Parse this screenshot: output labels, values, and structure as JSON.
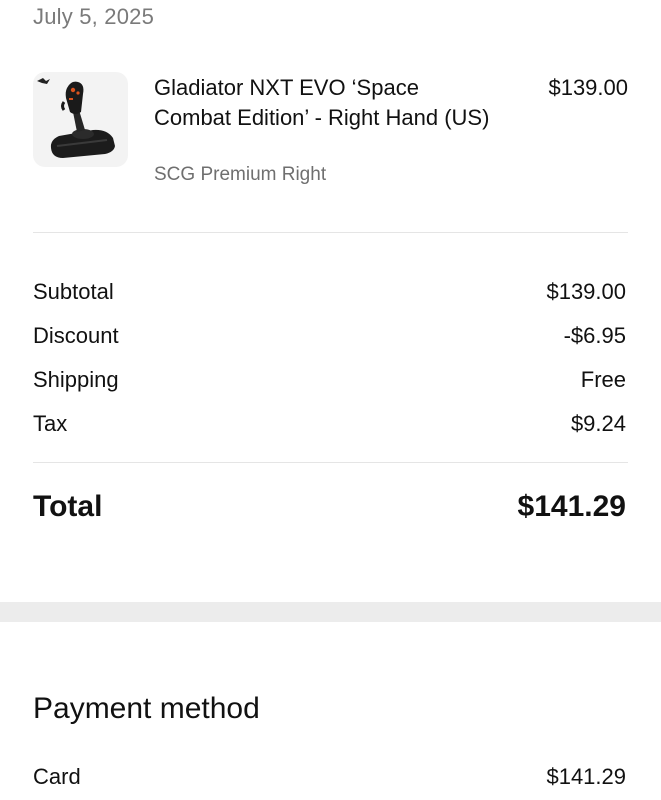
{
  "order": {
    "date": "July 5, 2025"
  },
  "product": {
    "title": "Gladiator NXT EVO ‘Space Combat Edition’ - Right Hand (US)",
    "variant": "SCG Premium Right",
    "price": "$139.00",
    "image_icon": "joystick-icon"
  },
  "summary": {
    "rows": [
      {
        "label": "Subtotal",
        "value": "$139.00"
      },
      {
        "label": "Discount",
        "value": "-$6.95"
      },
      {
        "label": "Shipping",
        "value": "Free"
      },
      {
        "label": "Tax",
        "value": "$9.24"
      }
    ],
    "total_label": "Total",
    "total_value": "$141.29"
  },
  "payment": {
    "heading": "Payment method",
    "method_label": "Card",
    "method_amount": "$141.29"
  },
  "colors": {
    "text": "#111111",
    "muted": "#7a7a7a",
    "divider": "#e5e5e5",
    "band": "#ececec",
    "thumb_bg": "#f3f3f3",
    "joystick_accent": "#d9531e"
  }
}
